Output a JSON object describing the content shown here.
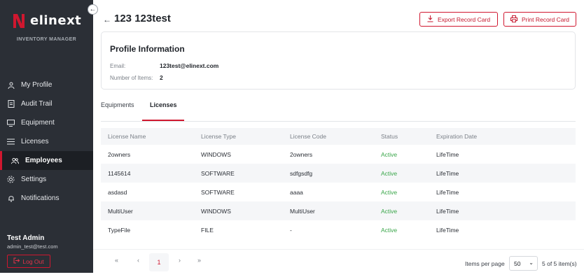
{
  "brand": {
    "name": "elinext",
    "subtitle": "INVENTORY MANAGER"
  },
  "nav": {
    "items": [
      {
        "label": "My Profile",
        "icon": "user-icon"
      },
      {
        "label": "Audit Trail",
        "icon": "document-icon"
      },
      {
        "label": "Equipment",
        "icon": "monitor-icon"
      },
      {
        "label": "Licenses",
        "icon": "list-icon"
      },
      {
        "label": "Employees",
        "icon": "users-icon"
      },
      {
        "label": "Settings",
        "icon": "gear-icon"
      },
      {
        "label": "Notifications",
        "icon": "bell-icon"
      }
    ],
    "active": "Employees"
  },
  "user": {
    "name": "Test Admin",
    "email": "admin_test@test.com"
  },
  "logout_label": "Log Out",
  "header": {
    "title": "123 123test",
    "export_label": "Export Record Card",
    "print_label": "Print Record Card"
  },
  "profile": {
    "title": "Profile Information",
    "email_label": "Email:",
    "email": "123test@elinext.com",
    "items_label": "Number of Items:",
    "items": "2"
  },
  "tabs": [
    {
      "label": "Equipments"
    },
    {
      "label": "Licenses"
    }
  ],
  "active_tab": "Licenses",
  "table": {
    "headers": [
      "License Name",
      "License Type",
      "License Code",
      "Status",
      "Expiration Date"
    ],
    "rows": [
      [
        "2owners",
        "WINDOWS",
        "2owners",
        "Active",
        "LifeTime"
      ],
      [
        "1145614",
        "SOFTWARE",
        "sdfgsdfg",
        "Active",
        "LifeTime"
      ],
      [
        "asdasd",
        "SOFTWARE",
        "aaaa",
        "Active",
        "LifeTime"
      ],
      [
        "MultiUser",
        "WINDOWS",
        "MultiUser",
        "Active",
        "LifeTime"
      ],
      [
        "TypeFile",
        "FILE",
        "-",
        "Active",
        "LifeTime"
      ]
    ]
  },
  "pager": {
    "first": "«",
    "prev": "‹",
    "page": "1",
    "next": "›",
    "last": "»",
    "items_per_page_label": "Items per page",
    "page_size": "50",
    "summary": "5 of 5 item(s)"
  },
  "colors": {
    "accent": "#d0172f",
    "sidebar": "#2b2f36",
    "status_active": "#3aa64a"
  }
}
